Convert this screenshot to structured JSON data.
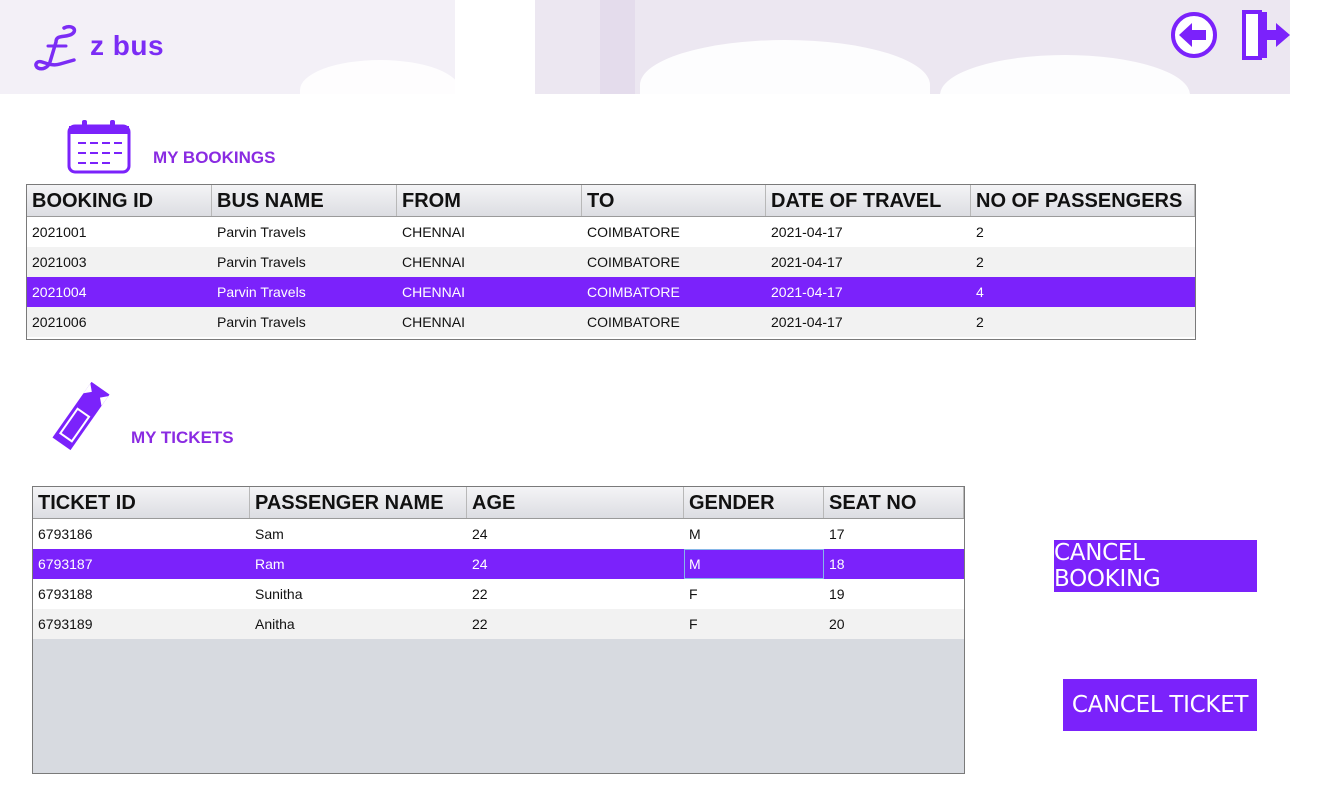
{
  "app": {
    "name": "z bus"
  },
  "colors": {
    "accent": "#7b22fb",
    "title": "#8a2be2"
  },
  "header": {
    "logo_icon": "stylized-l-logo-icon",
    "back_icon": "back-arrow-circle-icon",
    "logout_icon": "logout-door-arrow-icon"
  },
  "bookings": {
    "title": "MY BOOKINGS",
    "icon": "calendar-icon",
    "columns": [
      "BOOKING ID",
      "BUS NAME",
      "FROM",
      "TO",
      "DATE OF TRAVEL",
      "NO OF PASSENGERS"
    ],
    "rows": [
      [
        "2021001",
        "Parvin Travels",
        "CHENNAI",
        "COIMBATORE",
        "2021-04-17",
        "2"
      ],
      [
        "2021003",
        "Parvin Travels",
        "CHENNAI",
        "COIMBATORE",
        "2021-04-17",
        "2"
      ],
      [
        "2021004",
        "Parvin Travels",
        "CHENNAI",
        "COIMBATORE",
        "2021-04-17",
        "4"
      ],
      [
        "2021006",
        "Parvin Travels",
        "CHENNAI",
        "COIMBATORE",
        "2021-04-17",
        "2"
      ]
    ],
    "selected_row": 2
  },
  "tickets": {
    "title": "MY TICKETS",
    "icon": "ticket-icon",
    "columns": [
      "TICKET ID",
      "PASSENGER NAME",
      "AGE",
      "GENDER",
      "SEAT NO"
    ],
    "rows": [
      [
        "6793186",
        "Sam",
        "24",
        "M",
        "17"
      ],
      [
        "6793187",
        "Ram",
        "24",
        "M",
        "18"
      ],
      [
        "6793188",
        "Sunitha",
        "22",
        "F",
        "19"
      ],
      [
        "6793189",
        "Anitha",
        "22",
        "F",
        "20"
      ]
    ],
    "selected_row": 1
  },
  "actions": {
    "cancel_booking": "CANCEL BOOKING",
    "cancel_ticket": "CANCEL TICKET"
  }
}
